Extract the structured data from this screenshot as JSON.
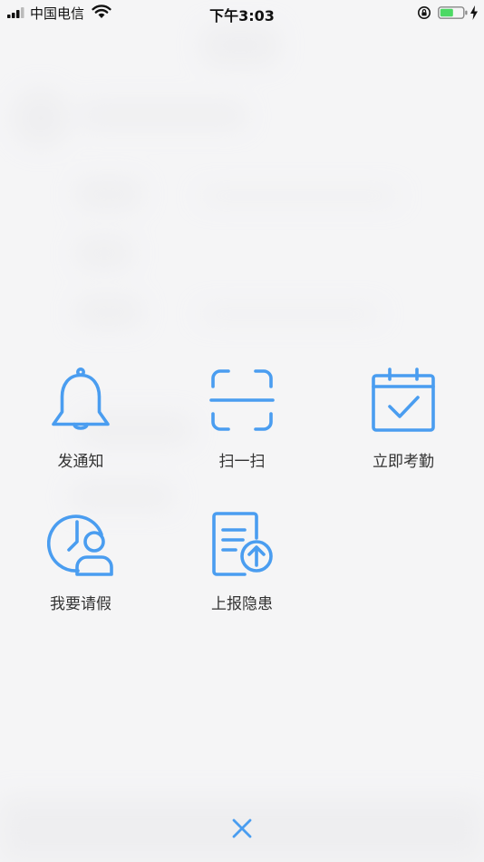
{
  "status_bar": {
    "carrier": "中国电信",
    "time": "下午3:03",
    "battery_color": "#4cd964"
  },
  "actions": [
    {
      "label": "发通知",
      "icon": "bell-icon"
    },
    {
      "label": "扫一扫",
      "icon": "scan-icon"
    },
    {
      "label": "立即考勤",
      "icon": "calendar-check-icon"
    },
    {
      "label": "我要请假",
      "icon": "clock-person-icon"
    },
    {
      "label": "上报隐患",
      "icon": "report-upload-icon"
    }
  ],
  "close": {
    "icon": "close-icon"
  },
  "accent_color": "#4a9df0"
}
